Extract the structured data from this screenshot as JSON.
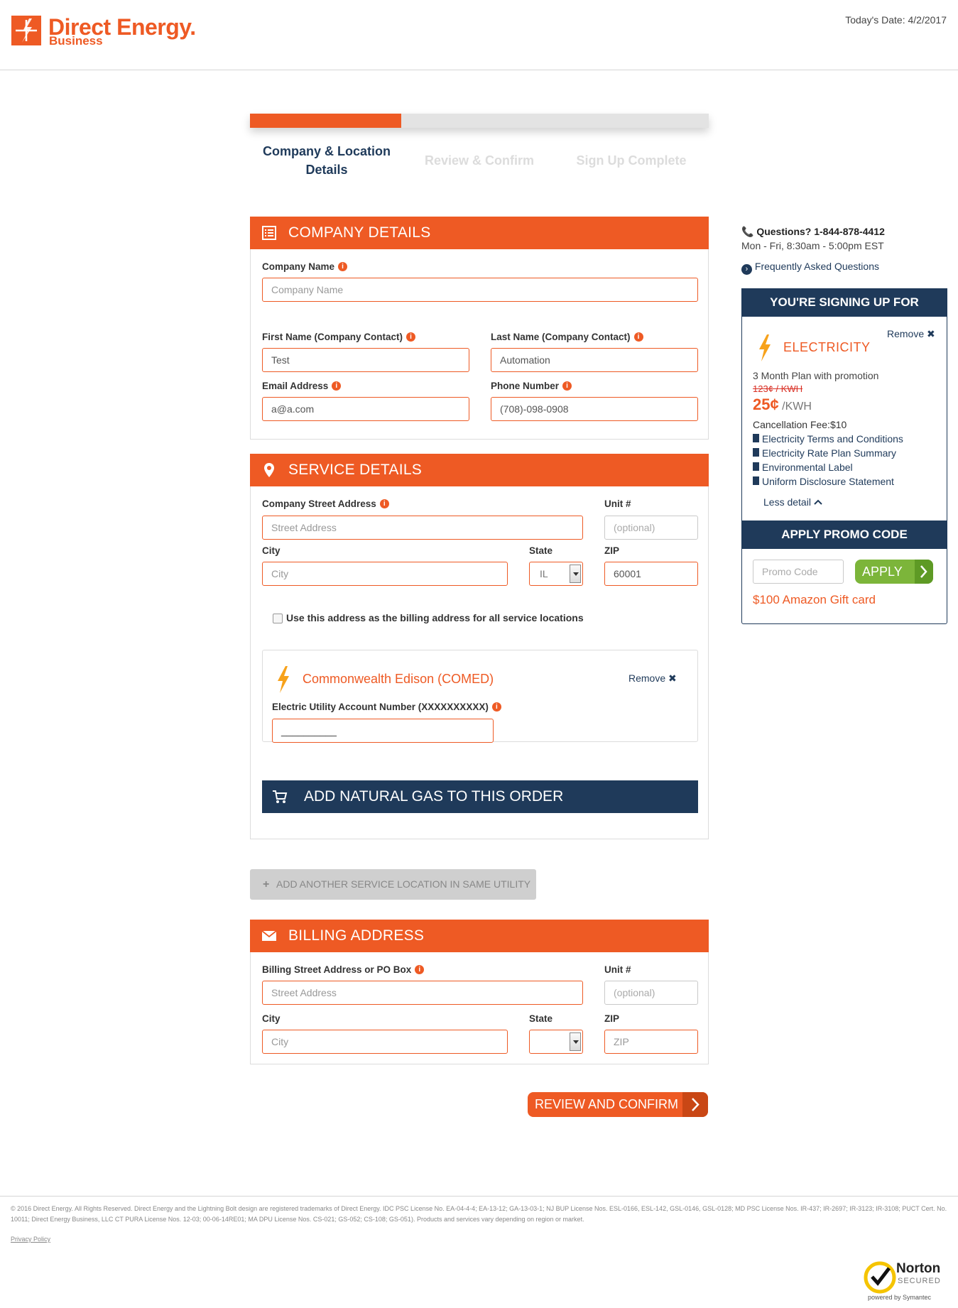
{
  "header": {
    "brand": "Direct Energy.",
    "brand_sub": "Business",
    "today_date": "Today's Date: 4/2/2017"
  },
  "progress": {
    "percent": 33,
    "steps": [
      {
        "label": "Company & Location Details",
        "state": "active"
      },
      {
        "label": "Review & Confirm",
        "state": "inactive"
      },
      {
        "label": "Sign Up Complete",
        "state": "inactive"
      }
    ]
  },
  "company_details": {
    "title": "COMPANY DETAILS",
    "company_name_label": "Company Name",
    "company_name_placeholder": "Company Name",
    "first_name_label": "First Name (Company Contact)",
    "first_name_value": "Test",
    "last_name_label": "Last Name (Company Contact)",
    "last_name_value": "Automation",
    "email_label": "Email Address",
    "email_value": "a@a.com",
    "phone_label": "Phone Number",
    "phone_value": "(708)-098-0908"
  },
  "service_details": {
    "title": "SERVICE DETAILS",
    "street_label": "Company Street Address",
    "street_placeholder": "Street Address",
    "unit_label": "Unit #",
    "unit_placeholder": "(optional)",
    "city_label": "City",
    "city_placeholder": "City",
    "state_label": "State",
    "state_value": "IL",
    "zip_label": "ZIP",
    "zip_value": "60001",
    "billing_checkbox_label": "Use this address as the billing address for all service locations",
    "utility": {
      "name": "Commonwealth Edison (COMED)",
      "remove_label": "Remove",
      "account_label": "Electric Utility Account Number (XXXXXXXXXX)",
      "account_value": "__________"
    },
    "add_gas_label": "ADD NATURAL GAS TO THIS ORDER"
  },
  "add_location_label": "ADD ANOTHER SERVICE LOCATION IN SAME UTILITY",
  "billing_address": {
    "title": "BILLING ADDRESS",
    "street_label": "Billing Street Address or PO Box",
    "street_placeholder": "Street Address",
    "unit_label": "Unit #",
    "unit_placeholder": "(optional)",
    "city_label": "City",
    "city_placeholder": "City",
    "state_label": "State",
    "state_value": "",
    "zip_label": "ZIP",
    "zip_placeholder": "ZIP"
  },
  "review_button_label": "REVIEW AND CONFIRM",
  "sidebar": {
    "questions": "Questions? 1-844-878-4412",
    "hours": "Mon - Fri, 8:30am - 5:00pm EST",
    "faq_link": "Frequently Asked Questions",
    "signing_up_title": "YOU'RE SIGNING UP FOR",
    "remove_label": "Remove",
    "product": "ELECTRICITY",
    "plan": "3 Month Plan with promotion",
    "old_price": "123¢ / KWH",
    "price": "25¢",
    "price_unit": "/KWH",
    "cancellation_fee": "Cancellation Fee:$10",
    "documents": [
      "Electricity Terms and Conditions",
      "Electricity Rate Plan Summary",
      "Environmental Label",
      "Uniform Disclosure Statement"
    ],
    "less_detail": "Less detail",
    "promo_title": "APPLY PROMO CODE",
    "promo_placeholder": "Promo Code",
    "apply_label": "APPLY",
    "promo_reward": "$100 Amazon Gift card"
  },
  "footer": {
    "legal": "© 2016 Direct Energy. All Rights Reserved. Direct Energy and the Lightning Bolt design are registered trademarks of Direct Energy. IDC PSC License No. EA-04-4-4; EA-13-12; GA-13-03-1; NJ BUP License Nos. ESL-0166, ESL-142, GSL-0146, GSL-0128; MD PSC License Nos. IR-437; IR-2697; IR-3123; IR-3108; PUCT Cert. No. 10011; Direct Energy Business, LLC CT PURA License Nos. 12-03; 00-06-14RE01; MA DPU License Nos. CS-021; GS-052; CS-108; GS-051). Products and services vary depending on region or market.",
    "privacy": "Privacy Policy",
    "norton_title": "Norton",
    "norton_secured": "SECURED",
    "norton_powered": "powered by Symantec"
  },
  "colors": {
    "orange": "#ee5a24",
    "navy": "#1f3a5a",
    "green": "#7cb53a"
  }
}
